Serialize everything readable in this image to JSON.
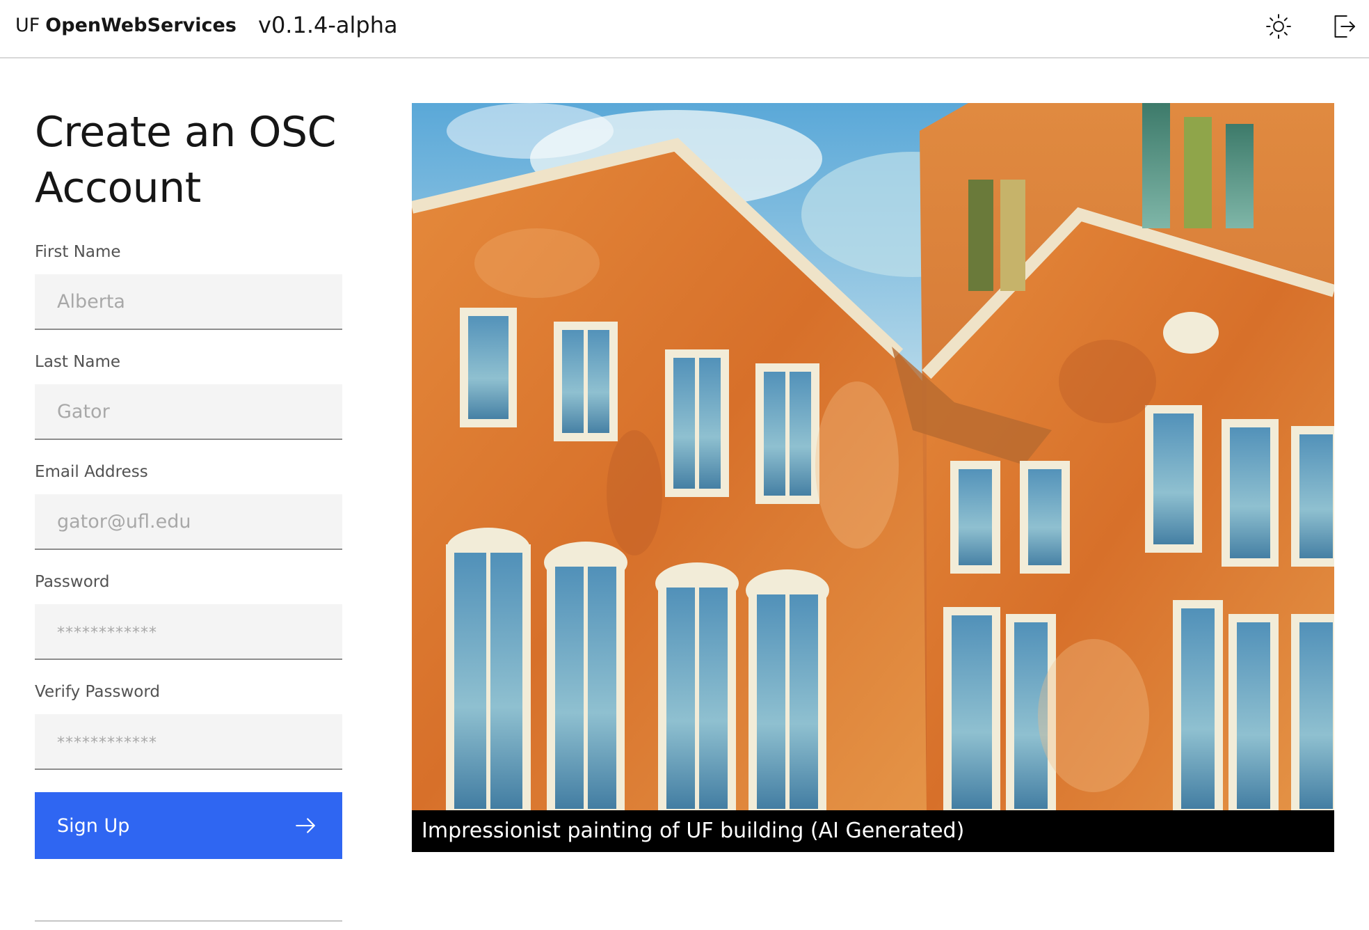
{
  "header": {
    "brand_prefix": "UF",
    "brand_name": "OpenWebServices",
    "version": "v0.1.4-alpha",
    "icons": [
      "sun-icon",
      "logout-icon"
    ]
  },
  "form": {
    "title": "Create an OSC Account",
    "fields": [
      {
        "label": "First Name",
        "placeholder": "Alberta"
      },
      {
        "label": "Last Name",
        "placeholder": "Gator"
      },
      {
        "label": "Email Address",
        "placeholder": "gator@ufl.edu"
      },
      {
        "label": "Password",
        "placeholder": "************"
      },
      {
        "label": "Verify Password",
        "placeholder": "************"
      }
    ],
    "submit_label": "Sign Up",
    "accent_color": "#2f66f2"
  },
  "image": {
    "caption": "Impressionist painting of UF building (AI Generated)"
  }
}
